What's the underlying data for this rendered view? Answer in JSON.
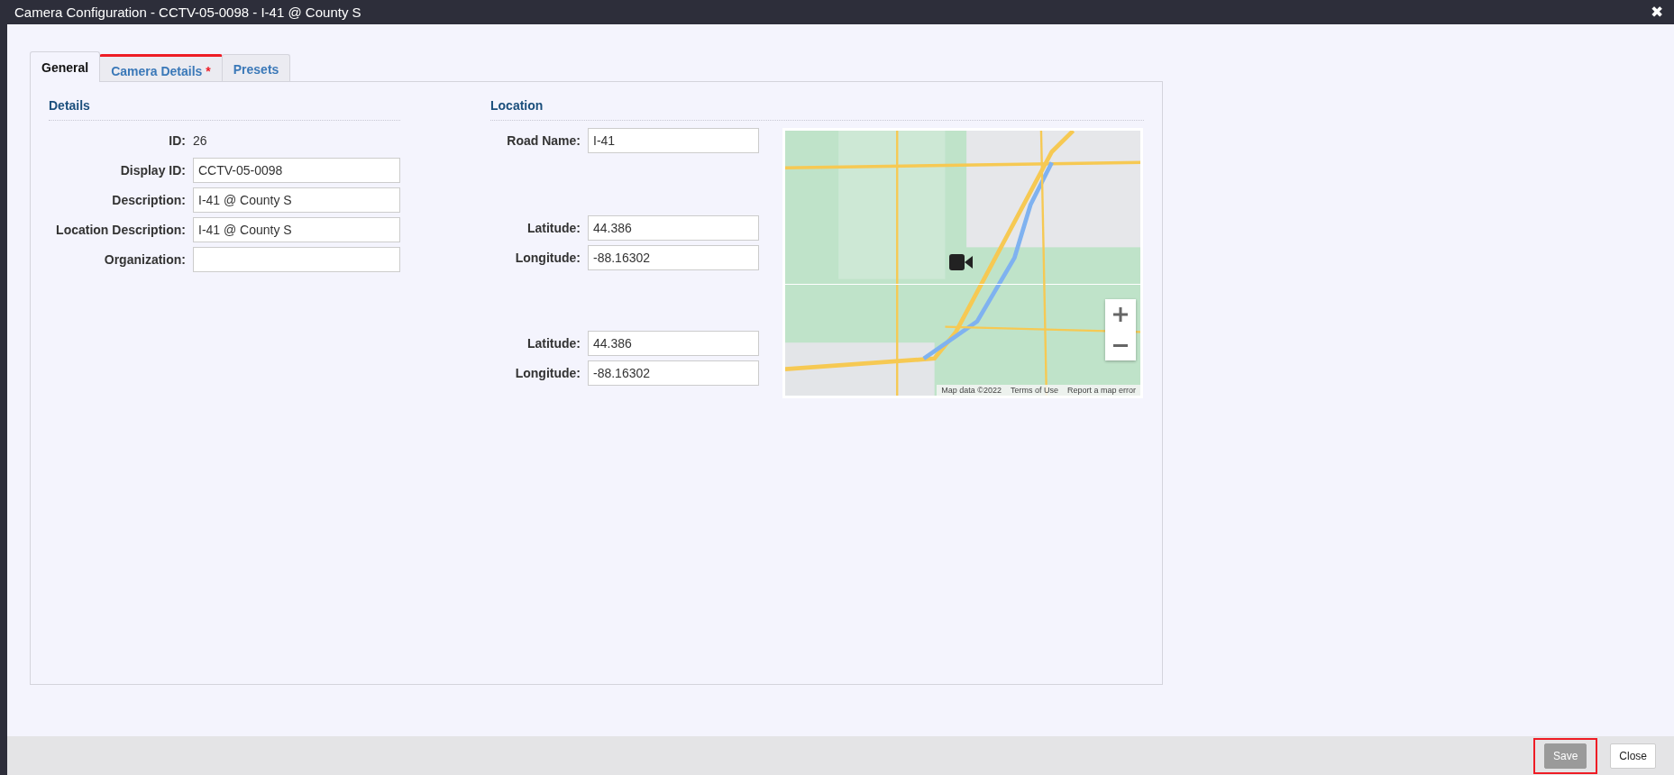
{
  "window": {
    "title": "Camera Configuration - CCTV-05-0098 - I-41 @ County S",
    "close": "✖"
  },
  "tabs": [
    {
      "label": "General",
      "selected": true,
      "error": false
    },
    {
      "label": "Camera Details",
      "selected": false,
      "error": true,
      "marker": "*"
    },
    {
      "label": "Presets",
      "selected": false,
      "error": false
    }
  ],
  "details": {
    "heading": "Details",
    "fields": [
      {
        "kind": "text",
        "label": "ID:",
        "value": "26"
      },
      {
        "kind": "input",
        "label": "Display ID:",
        "value": "CCTV-05-0098"
      },
      {
        "kind": "input",
        "label": "Description:",
        "value": "I-41 @ County S"
      },
      {
        "kind": "input",
        "label": "Location Description:",
        "value": "I-41 @ County S"
      },
      {
        "kind": "input",
        "label": "Organization:"
      }
    ]
  },
  "location": {
    "heading": "Location",
    "groups": [
      [
        {
          "label": "Road Name:",
          "value": "I-41"
        }
      ],
      [
        {
          "label": "Latitude:",
          "value": "44.386"
        },
        {
          "label": "Longitude:",
          "value": "-88.16302"
        }
      ],
      [
        {
          "label": "Latitude:",
          "value": "44.386"
        },
        {
          "label": "Longitude:",
          "value": "-88.16302"
        }
      ]
    ],
    "map": {
      "kind": "picture",
      "attribution": [
        "Map data ©2022",
        "Terms of Use",
        "Report a map error"
      ]
    }
  },
  "footer": {
    "buttons": [
      {
        "label": "Save",
        "disabled": true,
        "highlighted": true
      },
      {
        "label": "Close",
        "disabled": false,
        "highlighted": false
      }
    ]
  }
}
